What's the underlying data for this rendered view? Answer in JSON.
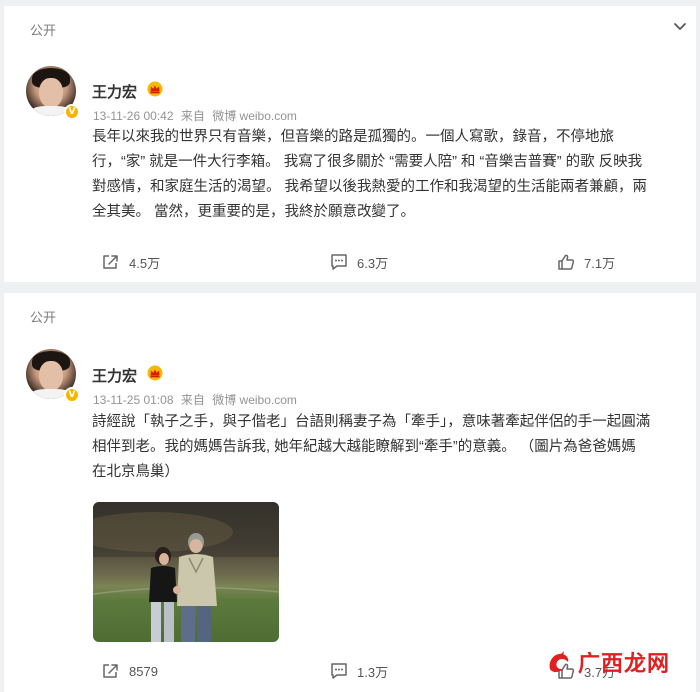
{
  "colors": {
    "background": "#eef0f2",
    "card": "#ffffff",
    "text": "#333333",
    "meta": "#939393",
    "badge": "#f7b500",
    "watermark": "#e02020"
  },
  "posts": [
    {
      "visibility": "公开",
      "author": "王力宏",
      "time": "13-11-26 00:42",
      "source_prefix": "来自",
      "source": "微博 weibo.com",
      "text": "長年以來我的世界只有音樂，但音樂的路是孤獨的。一個人寫歌，錄音，不停地旅\n行，“家” 就是一件大行李箱。 我寫了很多關於 “需要人陪” 和 “音樂吉普賽” 的歌 反映我\n對感情，和家庭生活的渴望。 我希望以後我熱愛的工作和我渴望的生活能兩者兼顧，兩\n全其美。 當然，更重要的是，我終於願意改變了。",
      "reposts": "4.5万",
      "comments": "6.3万",
      "likes": "7.1万"
    },
    {
      "visibility": "公开",
      "author": "王力宏",
      "time": "13-11-25 01:08",
      "source_prefix": "来自",
      "source": "微博 weibo.com",
      "text": "詩經說「執子之手，與子偕老」台語則稱妻子為「牽手」，意味著牽起伴侶的手一起圓滿\n相伴到老。我的媽媽告訴我, 她年紀越大越能瞭解到“牽手”的意義。 （圖片為爸爸媽媽\n在北京鳥巢）",
      "reposts": "8579",
      "comments": "1.3万",
      "likes": "3.7万"
    }
  ],
  "watermark": {
    "text": "广西龙网"
  },
  "icons": {
    "chevron": "chevron-down-icon",
    "repost": "share-icon",
    "comment": "comment-icon",
    "like": "thumbs-up-icon",
    "crown": "crown-badge-icon",
    "verified": "verified-v-icon"
  }
}
